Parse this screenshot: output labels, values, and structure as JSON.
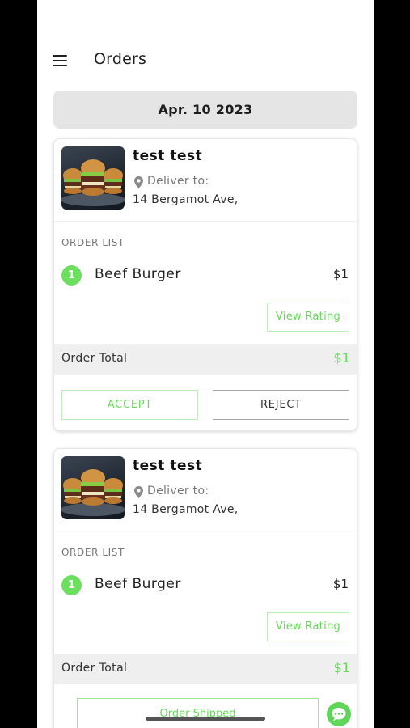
{
  "header": {
    "title": "Orders",
    "menu_icon": "hamburger-menu-icon"
  },
  "date": "Apr. 10 2023",
  "orders": [
    {
      "customer": "test test",
      "deliver_label": "Deliver to:",
      "address": "14 Bergamot Ave,",
      "list_label": "ORDER LIST",
      "items": [
        {
          "qty": "1",
          "name": "Beef Burger",
          "price": "$1"
        }
      ],
      "view_rating_label": "View Rating",
      "total_label": "Order Total",
      "total_value": "$1",
      "accept_label": "ACCEPT",
      "reject_label": "REJECT"
    },
    {
      "customer": "test test",
      "deliver_label": "Deliver to:",
      "address": "14 Bergamot Ave,",
      "list_label": "ORDER LIST",
      "items": [
        {
          "qty": "1",
          "name": "Beef Burger",
          "price": "$1"
        }
      ],
      "view_rating_label": "View Rating",
      "total_label": "Order Total",
      "total_value": "$1",
      "shipped_label": "Order Shipped",
      "chat_icon": "chat-bubble-icon"
    }
  ],
  "colors": {
    "accent_green": "#66db58",
    "badge_green": "#6ce05e",
    "date_pill_bg": "#e5e5e5",
    "total_bar_bg": "#efefef"
  }
}
